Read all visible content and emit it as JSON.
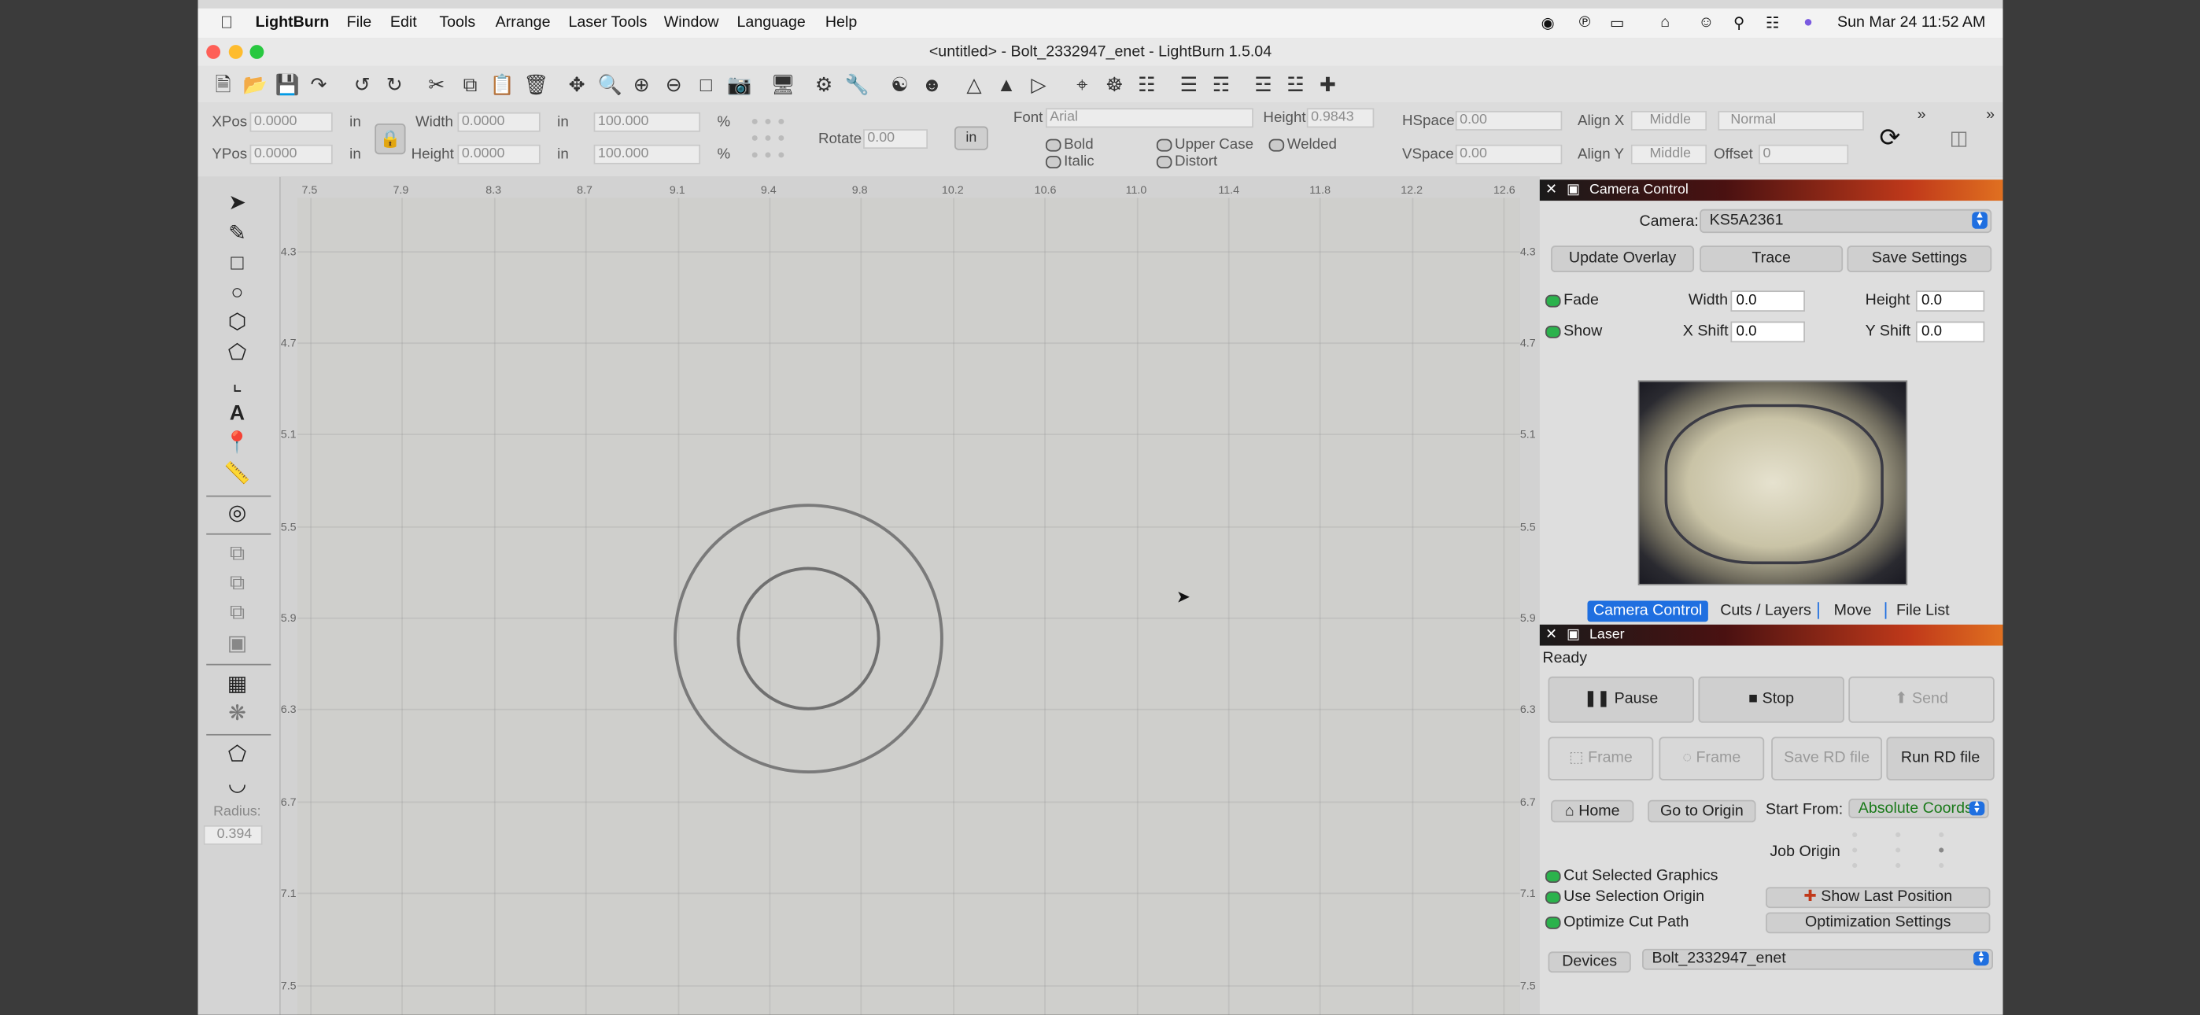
{
  "menubar": {
    "app_name": "LightBurn",
    "menus": [
      "File",
      "Edit",
      "Tools",
      "Arrange",
      "Laser Tools",
      "Window",
      "Language",
      "Help"
    ],
    "clock": "Sun Mar 24  11:52 AM"
  },
  "window": {
    "title": "<untitled> - Bolt_2332947_enet - LightBurn 1.5.04"
  },
  "toolbar_props": {
    "xpos_label": "XPos",
    "xpos_value": "0.0000",
    "ypos_label": "YPos",
    "ypos_value": "0.0000",
    "unit_in": "in",
    "width_label": "Width",
    "width_value": "0.0000",
    "height_label": "Height",
    "height_value": "0.0000",
    "scale_w": "100.000",
    "scale_h": "100.000",
    "percent": "%",
    "rotate_label": "Rotate",
    "rotate_value": "0.00",
    "in_button": "in",
    "font_label": "Font",
    "font_value": "Arial",
    "font_height_label": "Height",
    "font_height_value": "0.9843",
    "bold": "Bold",
    "italic": "Italic",
    "upper_case": "Upper Case",
    "distort": "Distort",
    "welded": "Welded",
    "hspace_label": "HSpace",
    "hspace_value": "0.00",
    "vspace_label": "VSpace",
    "vspace_value": "0.00",
    "alignx_label": "Align X",
    "alignx_value": "Middle",
    "aligny_label": "Align Y",
    "aligny_value": "Middle",
    "normal_value": "Normal",
    "offset_label": "Offset",
    "offset_value": "0"
  },
  "left_tools": {
    "radius_label": "Radius:",
    "radius_value": "0.394"
  },
  "rulers": {
    "top": [
      "7.5",
      "7.9",
      "8.3",
      "8.7",
      "9.1",
      "9.4",
      "9.8",
      "10.2",
      "10.6",
      "11.0",
      "11.4",
      "11.8",
      "12.2",
      "12.6"
    ],
    "left": [
      "4.3",
      "4.7",
      "5.1",
      "5.5",
      "5.9",
      "6.3",
      "6.7",
      "7.1",
      "7.5"
    ]
  },
  "camera_control": {
    "header": "Camera Control",
    "camera_label": "Camera:",
    "camera_value": "KS5A2361",
    "update_overlay": "Update Overlay",
    "trace": "Trace",
    "save_settings": "Save Settings",
    "fade": "Fade",
    "show": "Show",
    "width_label": "Width",
    "width_value": "0.0",
    "height_label": "Height",
    "height_value": "0.0",
    "xshift_label": "X Shift",
    "xshift_value": "0.0",
    "yshift_label": "Y Shift",
    "yshift_value": "0.0",
    "tabs": [
      "Camera Control",
      "Cuts / Layers",
      "Move",
      "File List"
    ],
    "active_tab": "Camera Control"
  },
  "laser": {
    "header": "Laser",
    "status": "Ready",
    "pause": "Pause",
    "stop": "Stop",
    "send": "Send",
    "frame1": "Frame",
    "frame2": "Frame",
    "save_rd": "Save RD file",
    "run_rd": "Run RD file",
    "home": "Home",
    "go_to_origin": "Go to Origin",
    "start_from_label": "Start From:",
    "start_from_value": "Absolute Coords",
    "job_origin": "Job Origin",
    "cut_selected": "Cut Selected Graphics",
    "use_selection_origin": "Use Selection Origin",
    "optimize_cut_path": "Optimize Cut Path",
    "show_last_position": "Show Last Position",
    "optimization_settings": "Optimization Settings",
    "devices": "Devices",
    "device_value": "Bolt_2332947_enet"
  },
  "colors": {
    "accent_blue": "#1f6fe0",
    "toggle_green": "#2bb24c",
    "header_gradient_end": "#e07020"
  }
}
